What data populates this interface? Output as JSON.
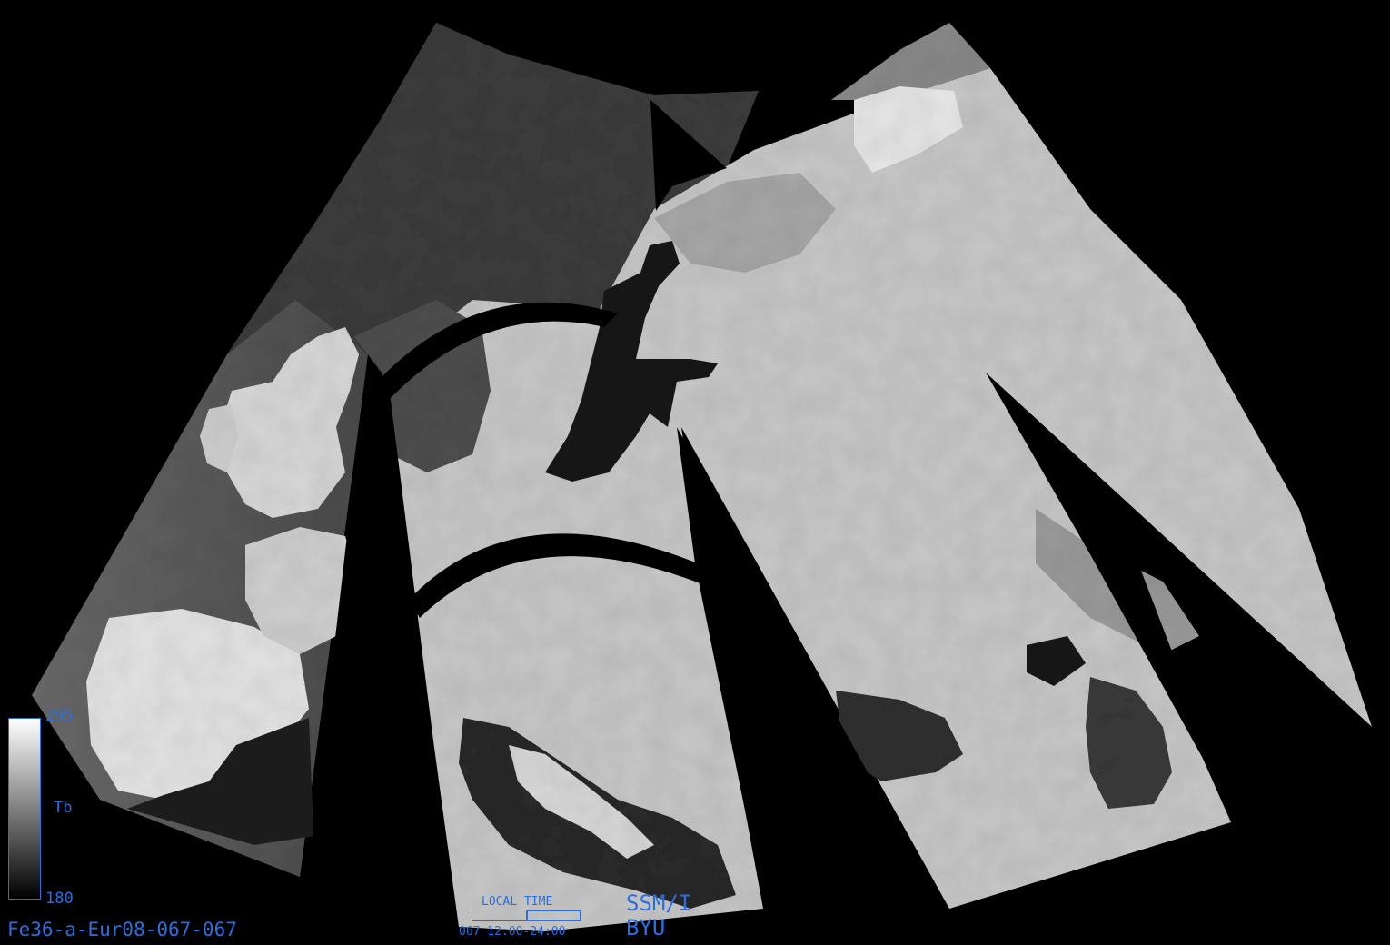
{
  "image": {
    "product_id": "Fe36-a-Eur08-067-067",
    "sensor": "SSM/I",
    "organization": "BYU"
  },
  "colorbar": {
    "max": "295",
    "min": "180",
    "unit": "Tb"
  },
  "local_time": {
    "title": "LOCAL TIME",
    "range": "067  12:00-24:00"
  },
  "colors": {
    "annotation": "#2a6fe0",
    "background": "#000000",
    "land_bright": "#e0e0e0",
    "water_dark": "#2a2a2a"
  }
}
